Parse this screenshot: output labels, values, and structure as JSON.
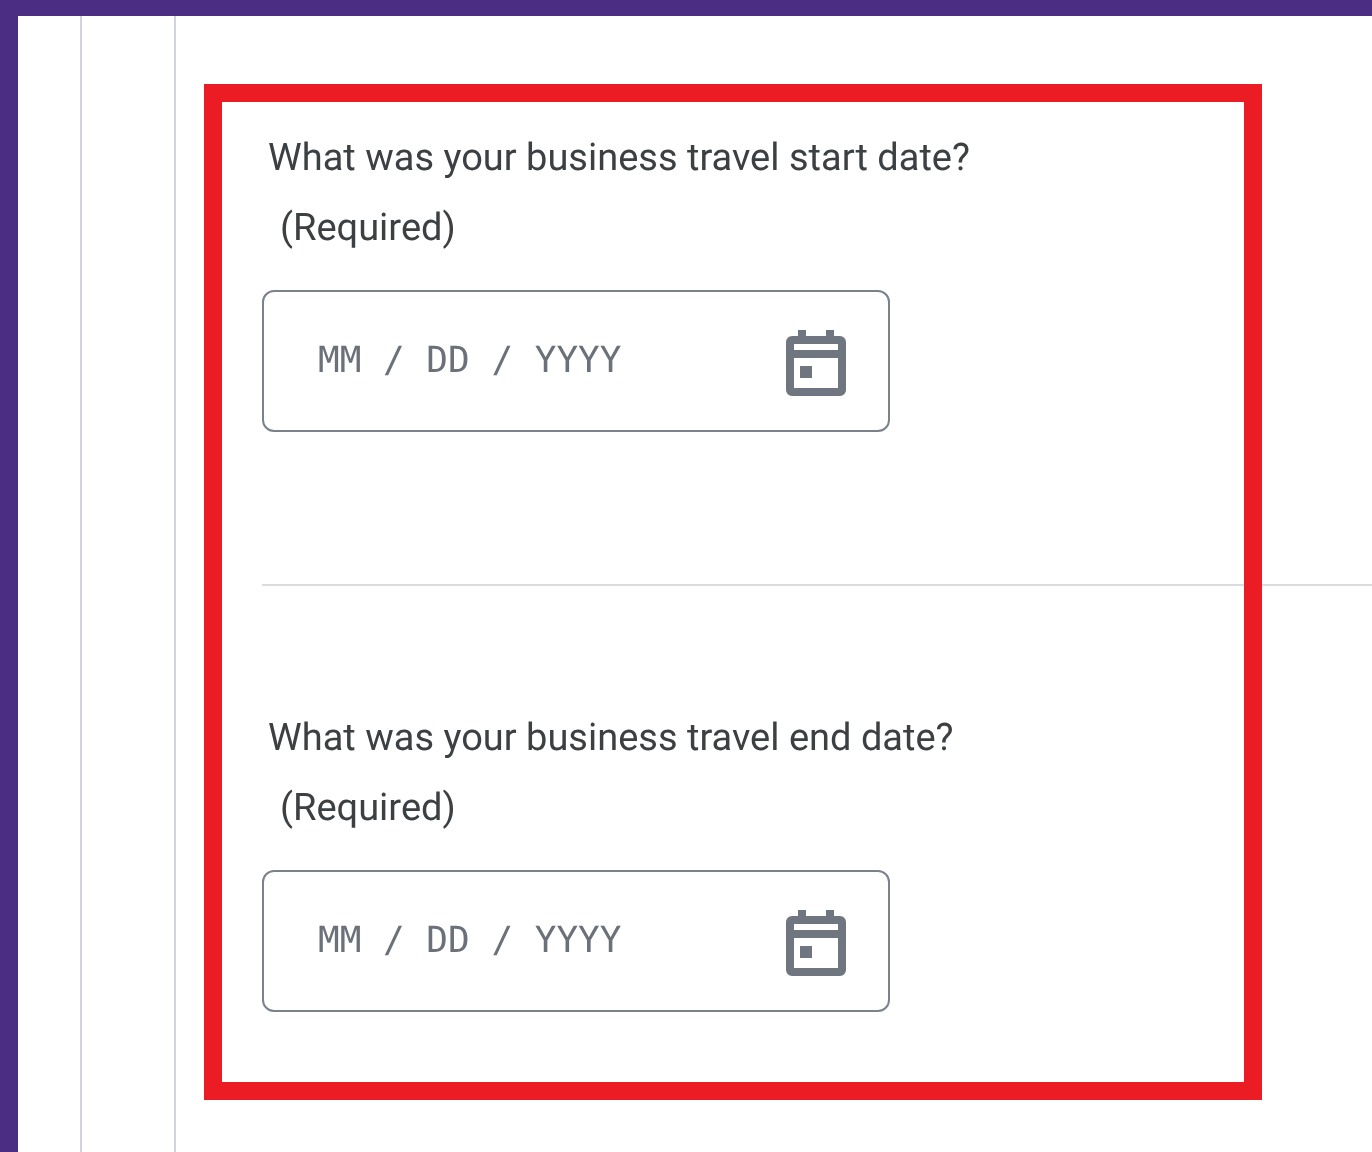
{
  "questions": [
    {
      "label": "What was your business travel start date?",
      "required_note": "(Required)",
      "placeholder": "MM / DD / YYYY"
    },
    {
      "label": "What was your business travel end date?",
      "required_note": "(Required)",
      "placeholder": "MM / DD / YYYY"
    }
  ]
}
